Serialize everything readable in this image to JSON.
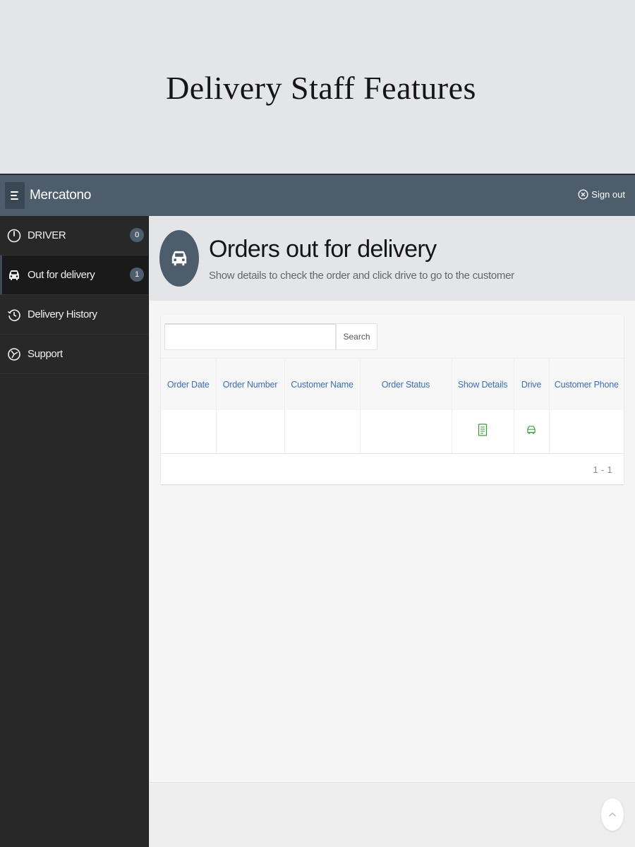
{
  "promo": {
    "title": "Delivery Staff Features"
  },
  "navbar": {
    "brand": "Mercatono",
    "signout_label": "Sign out",
    "menu_icon": "menu-icon",
    "signout_icon": "close-circle-icon",
    "color": "#4d5d6c"
  },
  "sidebar": {
    "background": "#282828",
    "items": [
      {
        "label": "DRIVER",
        "icon": "power-icon",
        "badge": "0",
        "active": false
      },
      {
        "label": "Out for delivery",
        "icon": "car-icon",
        "badge": "1",
        "active": true
      },
      {
        "label": "Delivery History",
        "icon": "history-icon",
        "active": false
      },
      {
        "label": "Support",
        "icon": "support-icon",
        "active": false
      }
    ]
  },
  "page": {
    "title": "Orders out for delivery",
    "subtitle": "Show details to check the order and click drive to go to the customer",
    "header_icon": "car-icon"
  },
  "search": {
    "placeholder": "",
    "value": "",
    "button_label": "Search"
  },
  "table": {
    "headers": [
      {
        "label": "Order Date"
      },
      {
        "label": "Order Number"
      },
      {
        "label": "Customer Name"
      },
      {
        "label": "Order Status"
      },
      {
        "label": "Show Details"
      },
      {
        "label": "Drive"
      },
      {
        "label": "Customer Phone"
      }
    ],
    "rows": [
      {
        "order_date": "",
        "order_number": "",
        "customer_name": "",
        "order_status": "",
        "show_details_icon": "document-icon",
        "drive_icon": "car-icon",
        "customer_phone": ""
      }
    ],
    "pagination": "1 - 1",
    "link_color": "#3c6eb4",
    "action_icon_color": "#3f9a3f"
  },
  "footer": {
    "scroll_top_icon": "chevron-up-icon"
  }
}
